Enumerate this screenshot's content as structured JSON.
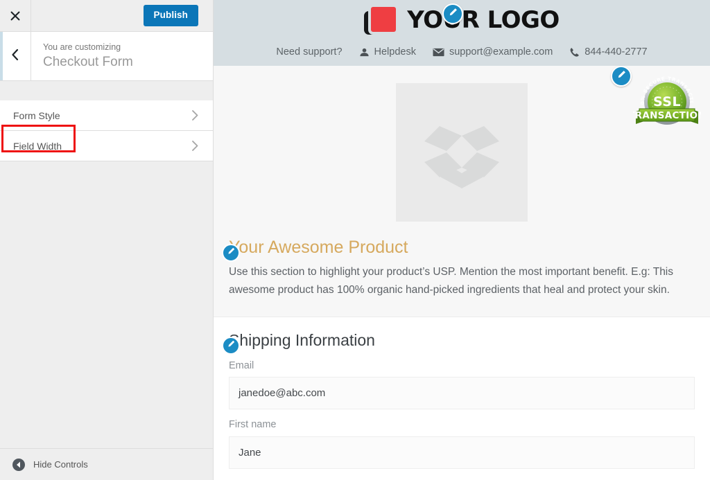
{
  "customizer": {
    "close_label": "Close customizer",
    "publish_label": "Publish",
    "eyebrow": "You are customizing",
    "title": "Checkout Form",
    "back_label": "Back",
    "controls": [
      {
        "label": "Form Style",
        "name": "form-style"
      },
      {
        "label": "Field Width",
        "name": "field-width",
        "highlighted": true
      }
    ],
    "hide_controls_label": "Hide Controls",
    "highlight_color": "#ee1111",
    "accent_color": "#0b76b8"
  },
  "preview": {
    "header": {
      "background_color": "#d6dee2",
      "logo_text": "YOUR LOGO",
      "logo_red": "#ef3e42",
      "logo_black": "#16181a",
      "support": [
        {
          "label": "Need support?",
          "icon": "none"
        },
        {
          "label": "Helpdesk",
          "icon": "agent-icon"
        },
        {
          "label": "support@example.com",
          "icon": "envelope-icon"
        },
        {
          "label": "844-440-2777",
          "icon": "phone-icon"
        }
      ]
    },
    "ssl_badge": {
      "arc_text": "100% SECURE TRANSACTION",
      "center_text": "SSL",
      "ribbon_text": "TRANSACTION"
    },
    "product": {
      "image_placeholder": "box-placeholder-icon",
      "title": "Your Awesome Product",
      "title_color": "#d6a95e",
      "description": "Use this section to highlight your product’s USP. Mention the most important benefit. E.g: This awesome product has 100% organic hand-picked ingredients that heal and protect your skin."
    },
    "shipping": {
      "title": "Shipping Information",
      "fields": [
        {
          "label": "Email",
          "value": "janedoe@abc.com",
          "name": "email-field"
        },
        {
          "label": "First name",
          "value": "Jane",
          "name": "first-name-field"
        }
      ]
    },
    "edit_pin_icon": "pencil-icon",
    "edit_pin_color": "#1b8cc4"
  }
}
